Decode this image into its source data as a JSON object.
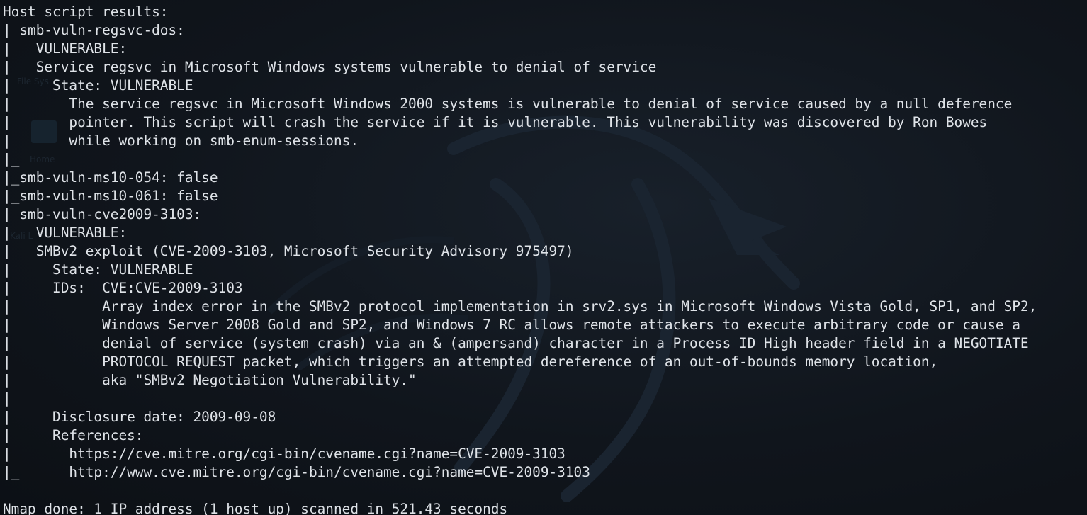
{
  "terminal": {
    "lines": [
      "Host script results:",
      "| smb-vuln-regsvc-dos:",
      "|   VULNERABLE:",
      "|   Service regsvc in Microsoft Windows systems vulnerable to denial of service",
      "|     State: VULNERABLE",
      "|       The service regsvc in Microsoft Windows 2000 systems is vulnerable to denial of service caused by a null deference",
      "|       pointer. This script will crash the service if it is vulnerable. This vulnerability was discovered by Ron Bowes",
      "|       while working on smb-enum-sessions.",
      "|_",
      "|_smb-vuln-ms10-054: false",
      "|_smb-vuln-ms10-061: false",
      "| smb-vuln-cve2009-3103:",
      "|   VULNERABLE:",
      "|   SMBv2 exploit (CVE-2009-3103, Microsoft Security Advisory 975497)",
      "|     State: VULNERABLE",
      "|     IDs:  CVE:CVE-2009-3103",
      "|           Array index error in the SMBv2 protocol implementation in srv2.sys in Microsoft Windows Vista Gold, SP1, and SP2,",
      "|           Windows Server 2008 Gold and SP2, and Windows 7 RC allows remote attackers to execute arbitrary code or cause a",
      "|           denial of service (system crash) via an & (ampersand) character in a Process ID High header field in a NEGOTIATE",
      "|           PROTOCOL REQUEST packet, which triggers an attempted dereference of an out-of-bounds memory location,",
      "|           aka \"SMBv2 Negotiation Vulnerability.\"",
      "|",
      "|     Disclosure date: 2009-09-08",
      "|     References:",
      "|       https://cve.mitre.org/cgi-bin/cvename.cgi?name=CVE-2009-3103",
      "|_      http://www.cve.mitre.org/cgi-bin/cvename.cgi?name=CVE-2009-3103",
      "",
      "Nmap done: 1 IP address (1 host up) scanned in 521.43 seconds"
    ]
  },
  "desktop_ghost": {
    "file_system_label": "File Sys",
    "home_label": "Home",
    "kali_label": "Kali L"
  },
  "colors": {
    "background": "#0f1319",
    "text": "#dfe3e8"
  }
}
